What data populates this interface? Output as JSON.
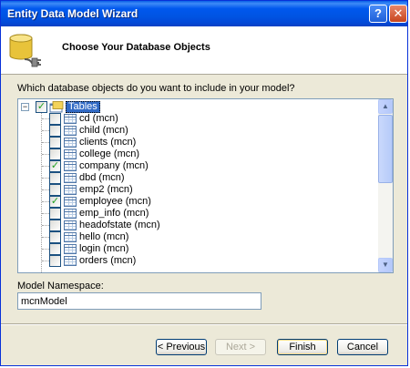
{
  "window": {
    "title": "Entity Data Model Wizard",
    "help_glyph": "?",
    "close_glyph": "✕"
  },
  "header": {
    "heading": "Choose Your Database Objects",
    "icon": "database-icon"
  },
  "prompt": "Which database objects do you want to include in your model?",
  "tree": {
    "root_label": "Tables",
    "root_checked": true,
    "expander_glyph": "−",
    "check_glyph": "✓",
    "items": [
      {
        "label": "cd (mcn)",
        "checked": false
      },
      {
        "label": "child (mcn)",
        "checked": false
      },
      {
        "label": "clients (mcn)",
        "checked": false
      },
      {
        "label": "college (mcn)",
        "checked": false
      },
      {
        "label": "company (mcn)",
        "checked": true
      },
      {
        "label": "dbd (mcn)",
        "checked": false
      },
      {
        "label": "emp2 (mcn)",
        "checked": false
      },
      {
        "label": "employee (mcn)",
        "checked": true
      },
      {
        "label": "emp_info (mcn)",
        "checked": false
      },
      {
        "label": "headofstate (mcn)",
        "checked": false
      },
      {
        "label": "hello (mcn)",
        "checked": false
      },
      {
        "label": "login (mcn)",
        "checked": false
      },
      {
        "label": "orders (mcn)",
        "checked": false
      }
    ]
  },
  "scrollbar": {
    "up_glyph": "▲",
    "down_glyph": "▼"
  },
  "namespace": {
    "label": "Model Namespace:",
    "value": "mcnModel"
  },
  "buttons": {
    "previous": "< Previous",
    "next": "Next >",
    "finish": "Finish",
    "cancel": "Cancel"
  },
  "colors": {
    "titlebar": "#0054e3",
    "selection": "#316ac5",
    "check": "#21a121"
  }
}
